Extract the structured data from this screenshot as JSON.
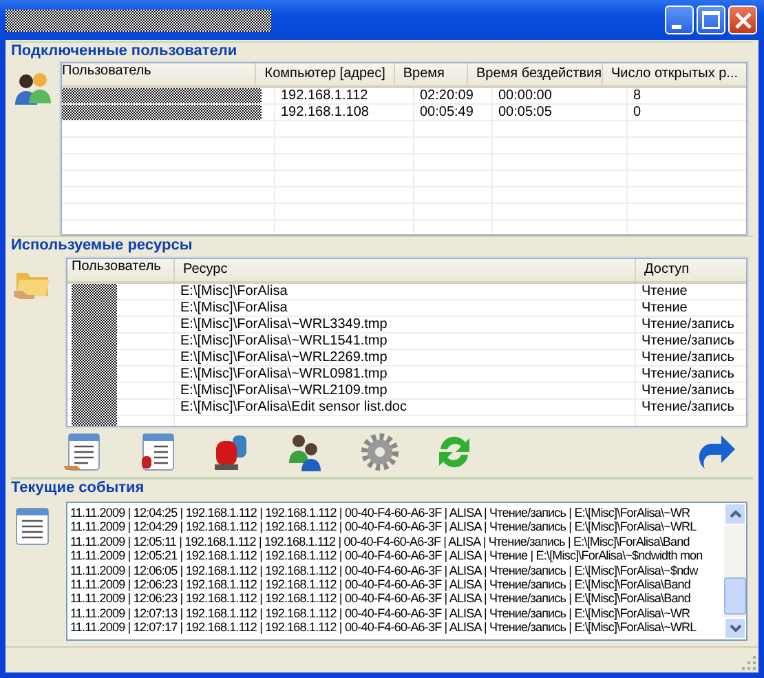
{
  "users": {
    "heading": "Подключенные пользователи",
    "columns": [
      "Пользователь",
      "Компьютер [адрес]",
      "Время",
      "Время бездействия",
      "Число открытых р..."
    ],
    "rows": [
      {
        "computer": "192.168.1.112",
        "time": "02:20:09",
        "idle": "00:00:00",
        "files": "8"
      },
      {
        "computer": "192.168.1.108",
        "time": "00:05:49",
        "idle": "00:05:05",
        "files": "0"
      }
    ]
  },
  "resources": {
    "heading": "Используемые ресурсы",
    "columns": [
      "Пользователь",
      "Ресурс",
      "Доступ"
    ],
    "rows": [
      {
        "resource": "E:\\[Misc]\\ForAlisa",
        "access": "Чтение"
      },
      {
        "resource": "E:\\[Misc]\\ForAlisa",
        "access": "Чтение"
      },
      {
        "resource": "E:\\[Misc]\\ForAlisa\\~WRL3349.tmp",
        "access": "Чтение/запись"
      },
      {
        "resource": "E:\\[Misc]\\ForAlisa\\~WRL1541.tmp",
        "access": "Чтение/запись"
      },
      {
        "resource": "E:\\[Misc]\\ForAlisa\\~WRL2269.tmp",
        "access": "Чтение/запись"
      },
      {
        "resource": "E:\\[Misc]\\ForAlisa\\~WRL0981.tmp",
        "access": "Чтение/запись"
      },
      {
        "resource": "E:\\[Misc]\\ForAlisa\\~WRL2109.tmp",
        "access": "Чтение/запись"
      },
      {
        "resource": "E:\\[Misc]\\ForAlisa\\Edit sensor list.doc",
        "access": "Чтение/запись"
      }
    ]
  },
  "events": {
    "heading": "Текущие события",
    "lines": [
      "11.11.2009 | 12:04:25 | 192.168.1.112 | 192.168.1.112 | 00-40-F4-60-A6-3F | ALISA | Чтение/запись | E:\\[Misc]\\ForAlisa\\~WR",
      "11.11.2009 | 12:04:29 | 192.168.1.112 | 192.168.1.112 | 00-40-F4-60-A6-3F | ALISA | Чтение/запись | E:\\[Misc]\\ForAlisa\\~WRL",
      "11.11.2009 | 12:05:11 | 192.168.1.112 | 192.168.1.112 | 00-40-F4-60-A6-3F | ALISA | Чтение/запись | E:\\[Misc]\\ForAlisa\\Band",
      "11.11.2009 | 12:05:21 | 192.168.1.112 | 192.168.1.112 | 00-40-F4-60-A6-3F | ALISA | Чтение | E:\\[Misc]\\ForAlisa\\~$ndwidth mon",
      "11.11.2009 | 12:06:05 | 192.168.1.112 | 192.168.1.112 | 00-40-F4-60-A6-3F | ALISA | Чтение/запись | E:\\[Misc]\\ForAlisa\\~$ndw",
      "11.11.2009 | 12:06:23 | 192.168.1.112 | 192.168.1.112 | 00-40-F4-60-A6-3F | ALISA | Чтение/запись | E:\\[Misc]\\ForAlisa\\Band",
      "11.11.2009 | 12:06:23 | 192.168.1.112 | 192.168.1.112 | 00-40-F4-60-A6-3F | ALISA | Чтение/запись | E:\\[Misc]\\ForAlisa\\Band",
      "11.11.2009 | 12:07:13 | 192.168.1.112 | 192.168.1.112 | 00-40-F4-60-A6-3F | ALISA | Чтение/запись | E:\\[Misc]\\ForAlisa\\~WR",
      "11.11.2009 | 12:07:17 | 192.168.1.112 | 192.168.1.112 | 00-40-F4-60-A6-3F | ALISA | Чтение/запись | E:\\[Misc]\\ForAlisa\\~WRL"
    ]
  }
}
